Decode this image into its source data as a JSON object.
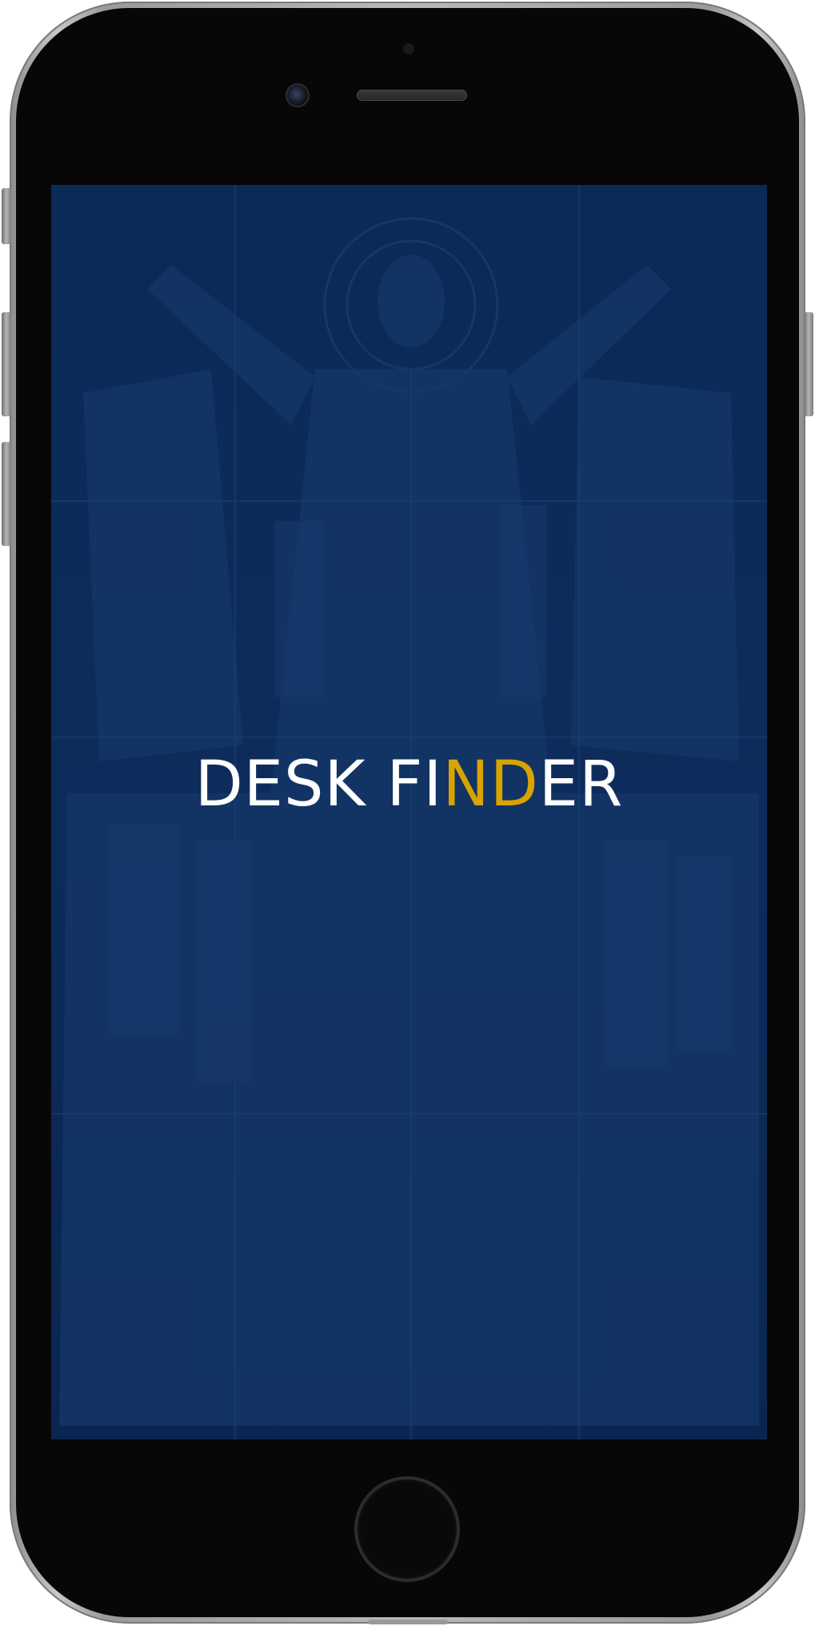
{
  "app": {
    "wordmark": {
      "part1": "DESK FI",
      "part2": "ND",
      "part3": "ER"
    }
  },
  "colors": {
    "screen_background": "#0b2a55",
    "accent_gold": "#d9a300",
    "text_white": "#ffffff",
    "device_frame": "#b9b9b9",
    "device_face": "#070707"
  },
  "icons": {
    "front_camera": "front-camera-icon",
    "earpiece": "earpiece-speaker-icon",
    "home_button": "home-button-icon"
  }
}
